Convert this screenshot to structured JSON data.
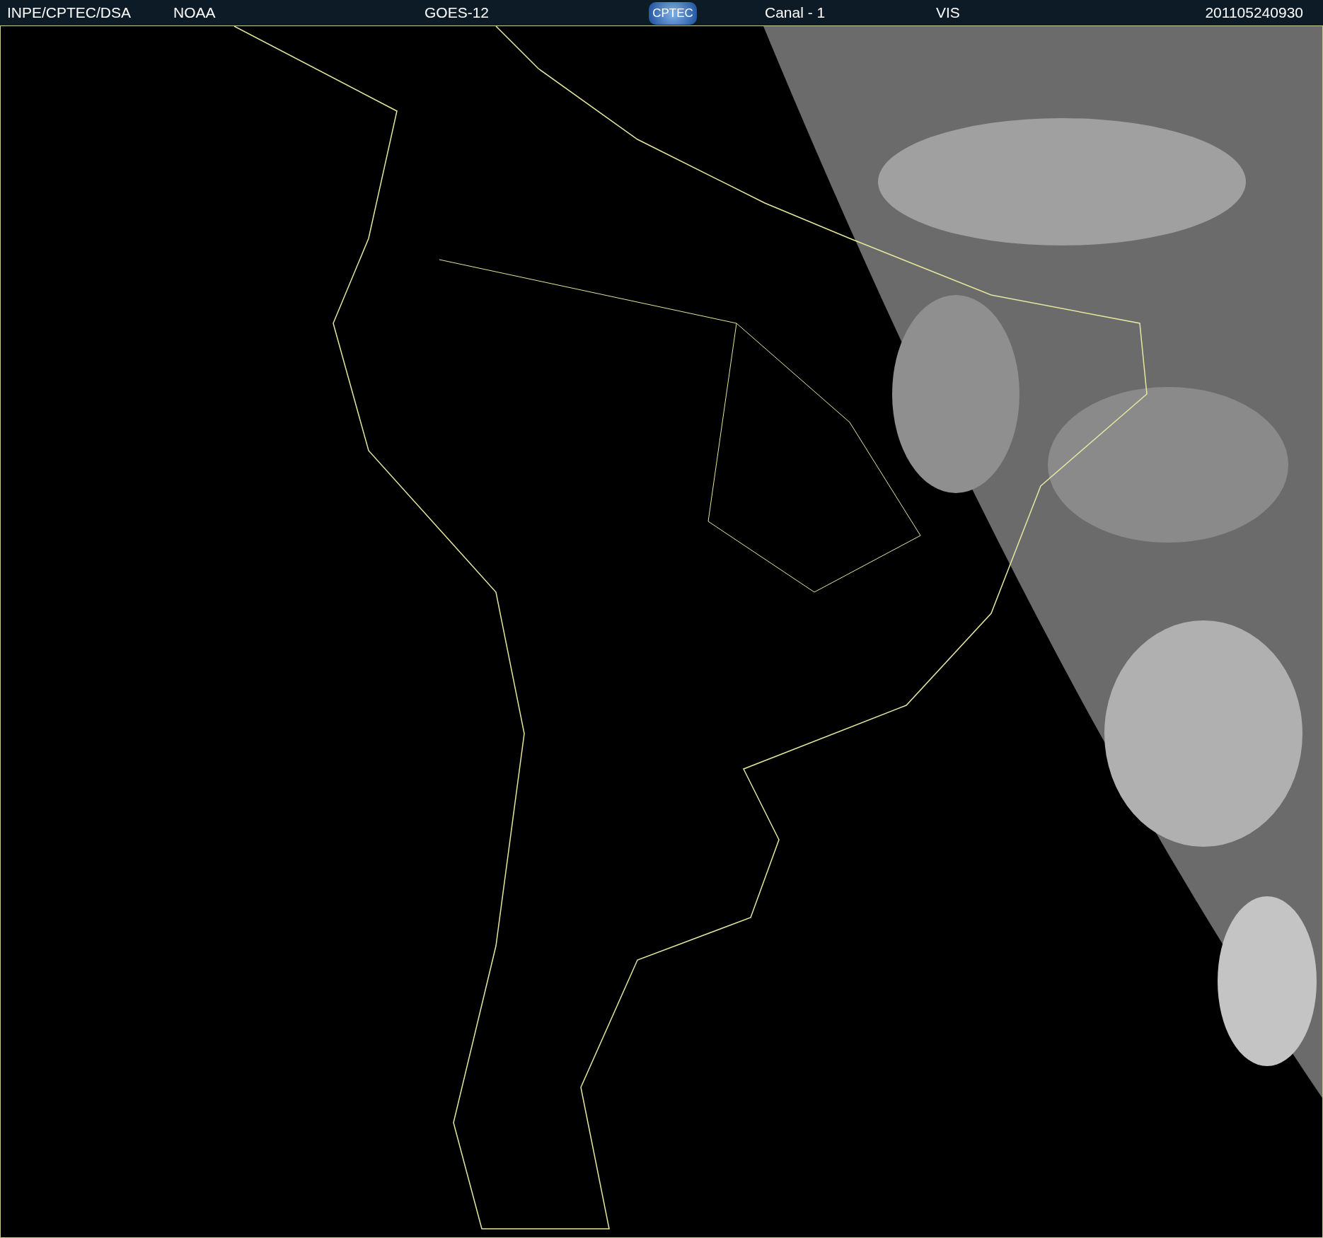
{
  "header": {
    "source": "INPE/CPTEC/DSA",
    "agency": "NOAA",
    "satellite": "GOES-12",
    "logo": "CPTEC",
    "channel": "Canal - 1",
    "band": "VIS",
    "timestamp": "201105240930"
  }
}
